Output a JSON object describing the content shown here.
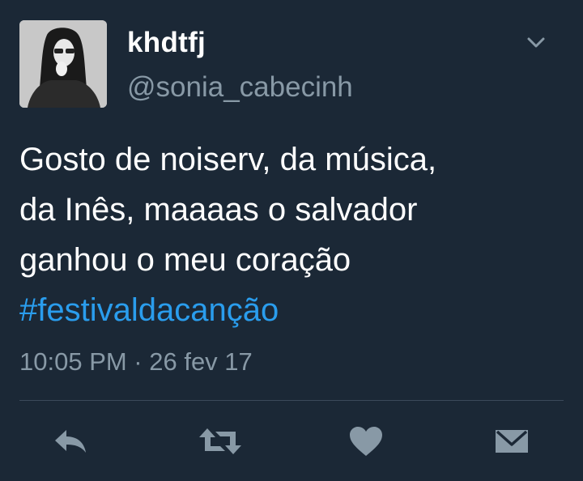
{
  "author": {
    "display_name": "khdtfj",
    "handle": "@sonia_cabecinh"
  },
  "tweet": {
    "text_lines": [
      "Gosto de noiserv, da música,",
      "da Inês, maaaas o salvador",
      "ganhou o meu coração"
    ],
    "hashtag": "#festivaldacanção",
    "timestamp": "10:05 PM · 26 fev 17"
  },
  "actions": [
    {
      "name": "reply",
      "icon": "reply-icon"
    },
    {
      "name": "retweet",
      "icon": "retweet-icon"
    },
    {
      "name": "like",
      "icon": "heart-icon"
    },
    {
      "name": "direct-message",
      "icon": "envelope-icon"
    }
  ],
  "colors": {
    "background": "#1b2836",
    "text": "#ffffff",
    "secondary_text": "#8899a6",
    "link": "#2a9ded",
    "icon": "#8899a6",
    "divider": "#3b4a5a"
  }
}
